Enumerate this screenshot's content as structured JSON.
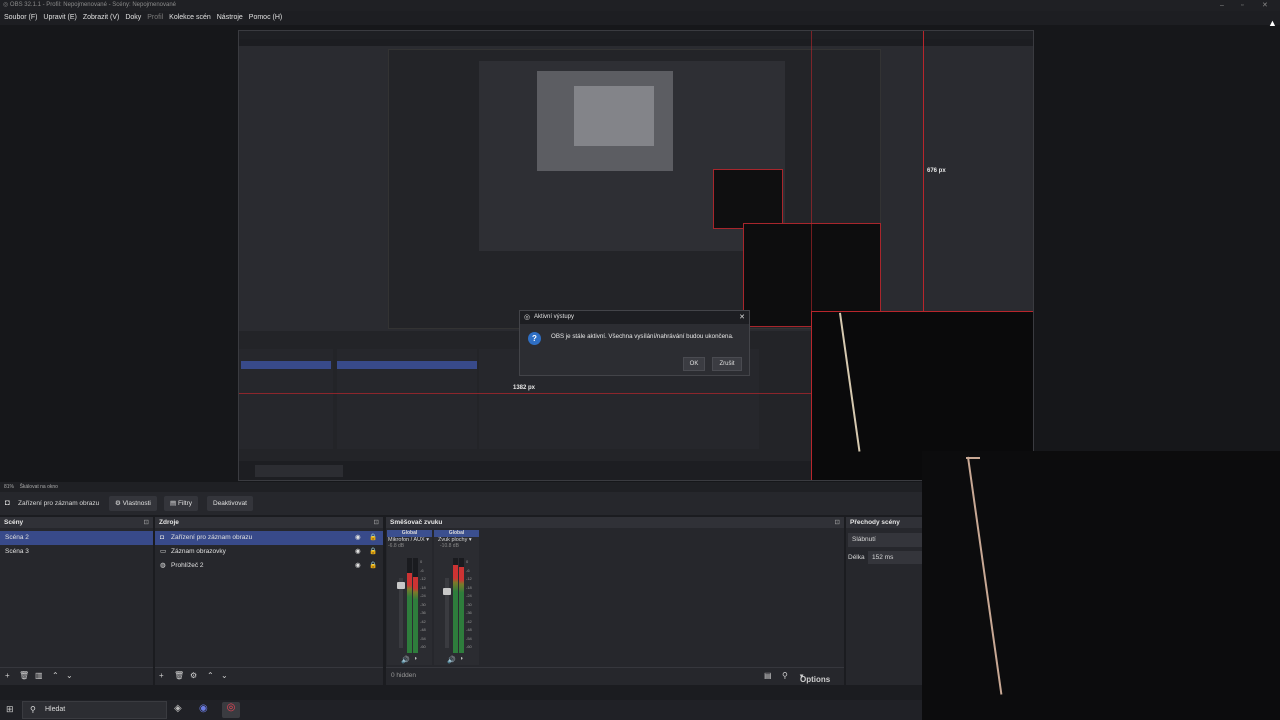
{
  "window": {
    "title": "OBS 32.1.1 - Profil: Nepojmenované - Scény: Nepojmenované"
  },
  "menu": [
    "Soubor (F)",
    "Upravit (E)",
    "Zobrazit (V)",
    "Doky",
    "Profil",
    "Kolekce scén",
    "Nástroje",
    "Pomoc (H)"
  ],
  "preview": {
    "height_label": "676 px",
    "width_label": "1382 px",
    "zoom": "81%",
    "zoom_mode": "Škálovat na okno"
  },
  "dialog": {
    "title": "Aktivní výstupy",
    "message": "OBS je stále aktivní. Všechna vysílání/nahrávání budou ukončena.",
    "ok": "OK",
    "cancel": "Zrušit"
  },
  "toolbar": {
    "source_name": "Zařízení pro záznam obrazu",
    "properties": "Vlastnosti",
    "filters": "Filtry",
    "deactivate": "Deaktivovat"
  },
  "scenes": {
    "title": "Scény",
    "items": [
      "Scéna 2",
      "Scéna 3"
    ]
  },
  "sources": {
    "title": "Zdroje",
    "items": [
      "Zařízení pro záznam obrazu",
      "Záznam obrazovky",
      "Prohlížeč 2"
    ]
  },
  "mixer": {
    "title": "Směšovač zvuku",
    "channels": [
      {
        "tag": "Global",
        "name": "Mikrofon / AUX",
        "db": "-6.8 dB"
      },
      {
        "tag": "Global",
        "name": "Zvuk plochy",
        "db": "-10.8 dB"
      }
    ],
    "scale": [
      "0",
      "-6",
      "-12",
      "-18",
      "-24",
      "-30",
      "-36",
      "-42",
      "-48",
      "-54",
      "-60"
    ],
    "hidden": "0 hidden",
    "options": "Options"
  },
  "transitions": {
    "title": "Přechody scény",
    "type": "Slábnutí",
    "duration_label": "Délka",
    "duration": "152 ms"
  },
  "taskbar": {
    "search": "Hledat"
  }
}
